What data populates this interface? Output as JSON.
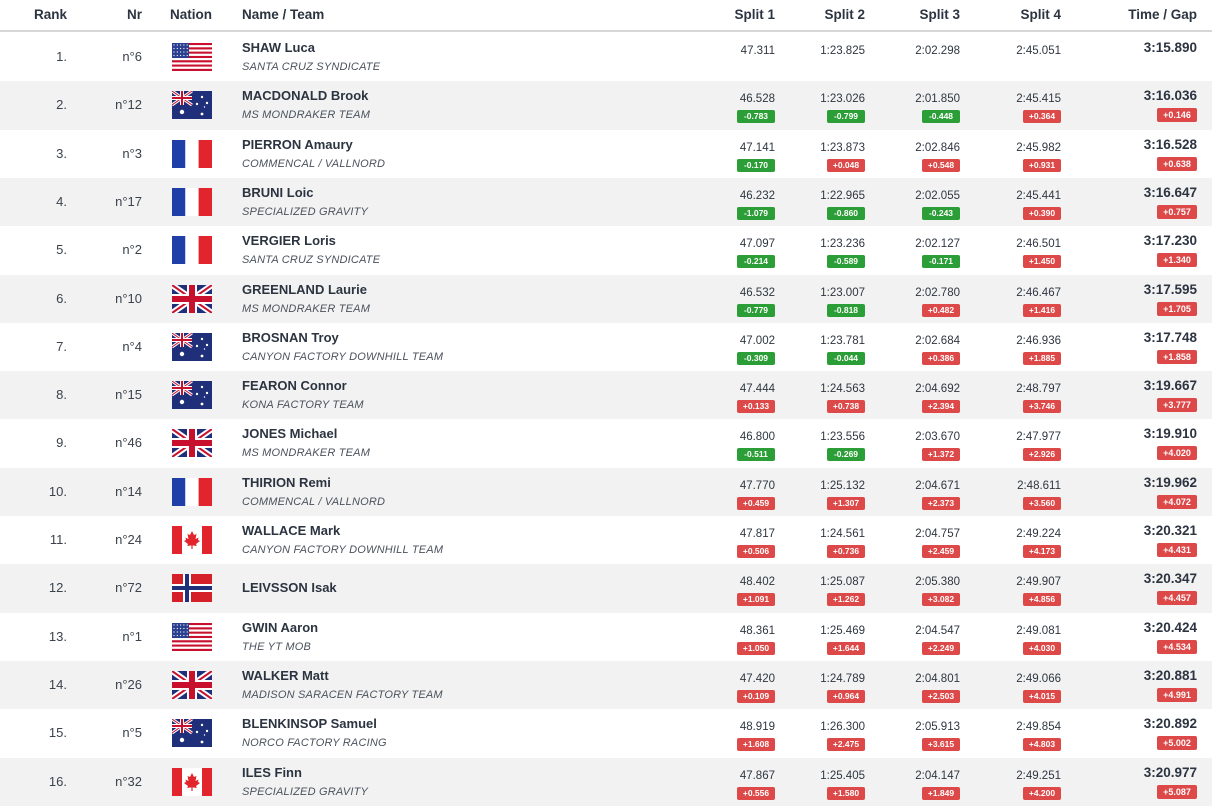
{
  "header": {
    "rank": "Rank",
    "nr": "Nr",
    "nation": "Nation",
    "name_team": "Name / Team",
    "split1": "Split 1",
    "split2": "Split 2",
    "split3": "Split 3",
    "split4": "Split 4",
    "time_gap": "Time / Gap"
  },
  "colors": {
    "faster": "#2c9e37",
    "slower": "#dd4848"
  },
  "riders": [
    {
      "rank": "1.",
      "nr": "n°6",
      "flag": "usa-flag",
      "name": "SHAW Luca",
      "team": "SANTA CRUZ SYNDICATE",
      "splits": [
        {
          "t": "47.311",
          "d": ""
        },
        {
          "t": "1:23.825",
          "d": ""
        },
        {
          "t": "2:02.298",
          "d": ""
        },
        {
          "t": "2:45.051",
          "d": ""
        }
      ],
      "time": "3:15.890",
      "gap": ""
    },
    {
      "rank": "2.",
      "nr": "n°12",
      "flag": "australia-flag",
      "name": "MACDONALD Brook",
      "team": "MS MONDRAKER TEAM",
      "splits": [
        {
          "t": "46.528",
          "d": "-0.783"
        },
        {
          "t": "1:23.026",
          "d": "-0.799"
        },
        {
          "t": "2:01.850",
          "d": "-0.448"
        },
        {
          "t": "2:45.415",
          "d": "+0.364"
        }
      ],
      "time": "3:16.036",
      "gap": "+0.146"
    },
    {
      "rank": "3.",
      "nr": "n°3",
      "flag": "france-flag",
      "name": "PIERRON Amaury",
      "team": "COMMENCAL / VALLNORD",
      "splits": [
        {
          "t": "47.141",
          "d": "-0.170"
        },
        {
          "t": "1:23.873",
          "d": "+0.048"
        },
        {
          "t": "2:02.846",
          "d": "+0.548"
        },
        {
          "t": "2:45.982",
          "d": "+0.931"
        }
      ],
      "time": "3:16.528",
      "gap": "+0.638"
    },
    {
      "rank": "4.",
      "nr": "n°17",
      "flag": "france-flag",
      "name": "BRUNI Loic",
      "team": "SPECIALIZED GRAVITY",
      "splits": [
        {
          "t": "46.232",
          "d": "-1.079"
        },
        {
          "t": "1:22.965",
          "d": "-0.860"
        },
        {
          "t": "2:02.055",
          "d": "-0.243"
        },
        {
          "t": "2:45.441",
          "d": "+0.390"
        }
      ],
      "time": "3:16.647",
      "gap": "+0.757"
    },
    {
      "rank": "5.",
      "nr": "n°2",
      "flag": "france-flag",
      "name": "VERGIER Loris",
      "team": "SANTA CRUZ SYNDICATE",
      "splits": [
        {
          "t": "47.097",
          "d": "-0.214"
        },
        {
          "t": "1:23.236",
          "d": "-0.589"
        },
        {
          "t": "2:02.127",
          "d": "-0.171"
        },
        {
          "t": "2:46.501",
          "d": "+1.450"
        }
      ],
      "time": "3:17.230",
      "gap": "+1.340"
    },
    {
      "rank": "6.",
      "nr": "n°10",
      "flag": "uk-flag",
      "name": "GREENLAND Laurie",
      "team": "MS MONDRAKER TEAM",
      "splits": [
        {
          "t": "46.532",
          "d": "-0.779"
        },
        {
          "t": "1:23.007",
          "d": "-0.818"
        },
        {
          "t": "2:02.780",
          "d": "+0.482"
        },
        {
          "t": "2:46.467",
          "d": "+1.416"
        }
      ],
      "time": "3:17.595",
      "gap": "+1.705"
    },
    {
      "rank": "7.",
      "nr": "n°4",
      "flag": "australia-flag",
      "name": "BROSNAN Troy",
      "team": "CANYON FACTORY DOWNHILL TEAM",
      "splits": [
        {
          "t": "47.002",
          "d": "-0.309"
        },
        {
          "t": "1:23.781",
          "d": "-0.044"
        },
        {
          "t": "2:02.684",
          "d": "+0.386"
        },
        {
          "t": "2:46.936",
          "d": "+1.885"
        }
      ],
      "time": "3:17.748",
      "gap": "+1.858"
    },
    {
      "rank": "8.",
      "nr": "n°15",
      "flag": "australia-flag",
      "name": "FEARON Connor",
      "team": "KONA FACTORY TEAM",
      "splits": [
        {
          "t": "47.444",
          "d": "+0.133"
        },
        {
          "t": "1:24.563",
          "d": "+0.738"
        },
        {
          "t": "2:04.692",
          "d": "+2.394"
        },
        {
          "t": "2:48.797",
          "d": "+3.746"
        }
      ],
      "time": "3:19.667",
      "gap": "+3.777"
    },
    {
      "rank": "9.",
      "nr": "n°46",
      "flag": "uk-flag",
      "name": "JONES Michael",
      "team": "MS MONDRAKER TEAM",
      "splits": [
        {
          "t": "46.800",
          "d": "-0.511"
        },
        {
          "t": "1:23.556",
          "d": "-0.269"
        },
        {
          "t": "2:03.670",
          "d": "+1.372"
        },
        {
          "t": "2:47.977",
          "d": "+2.926"
        }
      ],
      "time": "3:19.910",
      "gap": "+4.020"
    },
    {
      "rank": "10.",
      "nr": "n°14",
      "flag": "france-flag",
      "name": "THIRION Remi",
      "team": "COMMENCAL / VALLNORD",
      "splits": [
        {
          "t": "47.770",
          "d": "+0.459"
        },
        {
          "t": "1:25.132",
          "d": "+1.307"
        },
        {
          "t": "2:04.671",
          "d": "+2.373"
        },
        {
          "t": "2:48.611",
          "d": "+3.560"
        }
      ],
      "time": "3:19.962",
      "gap": "+4.072"
    },
    {
      "rank": "11.",
      "nr": "n°24",
      "flag": "canada-flag",
      "name": "WALLACE Mark",
      "team": "CANYON FACTORY DOWNHILL TEAM",
      "splits": [
        {
          "t": "47.817",
          "d": "+0.506"
        },
        {
          "t": "1:24.561",
          "d": "+0.736"
        },
        {
          "t": "2:04.757",
          "d": "+2.459"
        },
        {
          "t": "2:49.224",
          "d": "+4.173"
        }
      ],
      "time": "3:20.321",
      "gap": "+4.431"
    },
    {
      "rank": "12.",
      "nr": "n°72",
      "flag": "norway-flag",
      "name": "LEIVSSON Isak",
      "team": "",
      "splits": [
        {
          "t": "48.402",
          "d": "+1.091"
        },
        {
          "t": "1:25.087",
          "d": "+1.262"
        },
        {
          "t": "2:05.380",
          "d": "+3.082"
        },
        {
          "t": "2:49.907",
          "d": "+4.856"
        }
      ],
      "time": "3:20.347",
      "gap": "+4.457"
    },
    {
      "rank": "13.",
      "nr": "n°1",
      "flag": "usa-flag",
      "name": "GWIN Aaron",
      "team": "THE YT MOB",
      "splits": [
        {
          "t": "48.361",
          "d": "+1.050"
        },
        {
          "t": "1:25.469",
          "d": "+1.644"
        },
        {
          "t": "2:04.547",
          "d": "+2.249"
        },
        {
          "t": "2:49.081",
          "d": "+4.030"
        }
      ],
      "time": "3:20.424",
      "gap": "+4.534"
    },
    {
      "rank": "14.",
      "nr": "n°26",
      "flag": "uk-flag",
      "name": "WALKER Matt",
      "team": "MADISON SARACEN FACTORY TEAM",
      "splits": [
        {
          "t": "47.420",
          "d": "+0.109"
        },
        {
          "t": "1:24.789",
          "d": "+0.964"
        },
        {
          "t": "2:04.801",
          "d": "+2.503"
        },
        {
          "t": "2:49.066",
          "d": "+4.015"
        }
      ],
      "time": "3:20.881",
      "gap": "+4.991"
    },
    {
      "rank": "15.",
      "nr": "n°5",
      "flag": "australia-flag",
      "name": "BLENKINSOP Samuel",
      "team": "NORCO FACTORY RACING",
      "splits": [
        {
          "t": "48.919",
          "d": "+1.608"
        },
        {
          "t": "1:26.300",
          "d": "+2.475"
        },
        {
          "t": "2:05.913",
          "d": "+3.615"
        },
        {
          "t": "2:49.854",
          "d": "+4.803"
        }
      ],
      "time": "3:20.892",
      "gap": "+5.002"
    },
    {
      "rank": "16.",
      "nr": "n°32",
      "flag": "canada-flag",
      "name": "ILES Finn",
      "team": "SPECIALIZED GRAVITY",
      "splits": [
        {
          "t": "47.867",
          "d": "+0.556"
        },
        {
          "t": "1:25.405",
          "d": "+1.580"
        },
        {
          "t": "2:04.147",
          "d": "+1.849"
        },
        {
          "t": "2:49.251",
          "d": "+4.200"
        }
      ],
      "time": "3:20.977",
      "gap": "+5.087"
    }
  ]
}
